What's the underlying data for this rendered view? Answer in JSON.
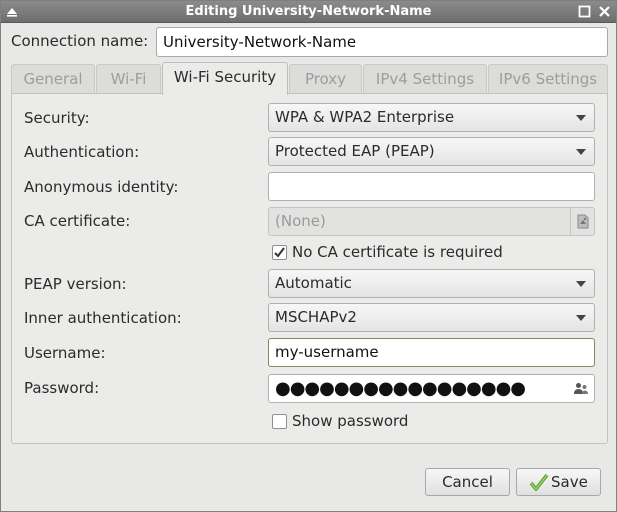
{
  "window": {
    "title": "Editing University-Network-Name"
  },
  "connection": {
    "label": "Connection name:",
    "value": "University-Network-Name"
  },
  "tabs": [
    {
      "label": "General",
      "active": false
    },
    {
      "label": "Wi-Fi",
      "active": false
    },
    {
      "label": "Wi-Fi Security",
      "active": true
    },
    {
      "label": "Proxy",
      "active": false
    },
    {
      "label": "IPv4 Settings",
      "active": false
    },
    {
      "label": "IPv6 Settings",
      "active": false
    }
  ],
  "security": {
    "security_label": "Security:",
    "security_value": "WPA & WPA2 Enterprise",
    "auth_label": "Authentication:",
    "auth_value": "Protected EAP (PEAP)",
    "anon_label": "Anonymous identity:",
    "anon_value": "",
    "ca_label": "CA certificate:",
    "ca_value": "(None)",
    "no_ca_label": "No CA certificate is required",
    "no_ca_checked": true,
    "peap_label": "PEAP version:",
    "peap_value": "Automatic",
    "inner_label": "Inner authentication:",
    "inner_value": "MSCHAPv2",
    "username_label": "Username:",
    "username_value": "my-username",
    "password_label": "Password:",
    "password_mask": "●●●●●●●●●●●●●●●●●",
    "show_password_label": "Show password",
    "show_password_checked": false
  },
  "buttons": {
    "cancel": "Cancel",
    "save": "Save"
  },
  "icons": {
    "window_menu": "window-menu-icon",
    "maximize": "maximize-icon",
    "close": "close-icon",
    "dropdown": "chevron-down-icon",
    "certificate": "certificate-file-icon",
    "password_storage": "users-icon",
    "save": "checkmark-icon"
  },
  "colors": {
    "titlebar": "#7a7a7a",
    "save_check": "#5aa02c"
  }
}
